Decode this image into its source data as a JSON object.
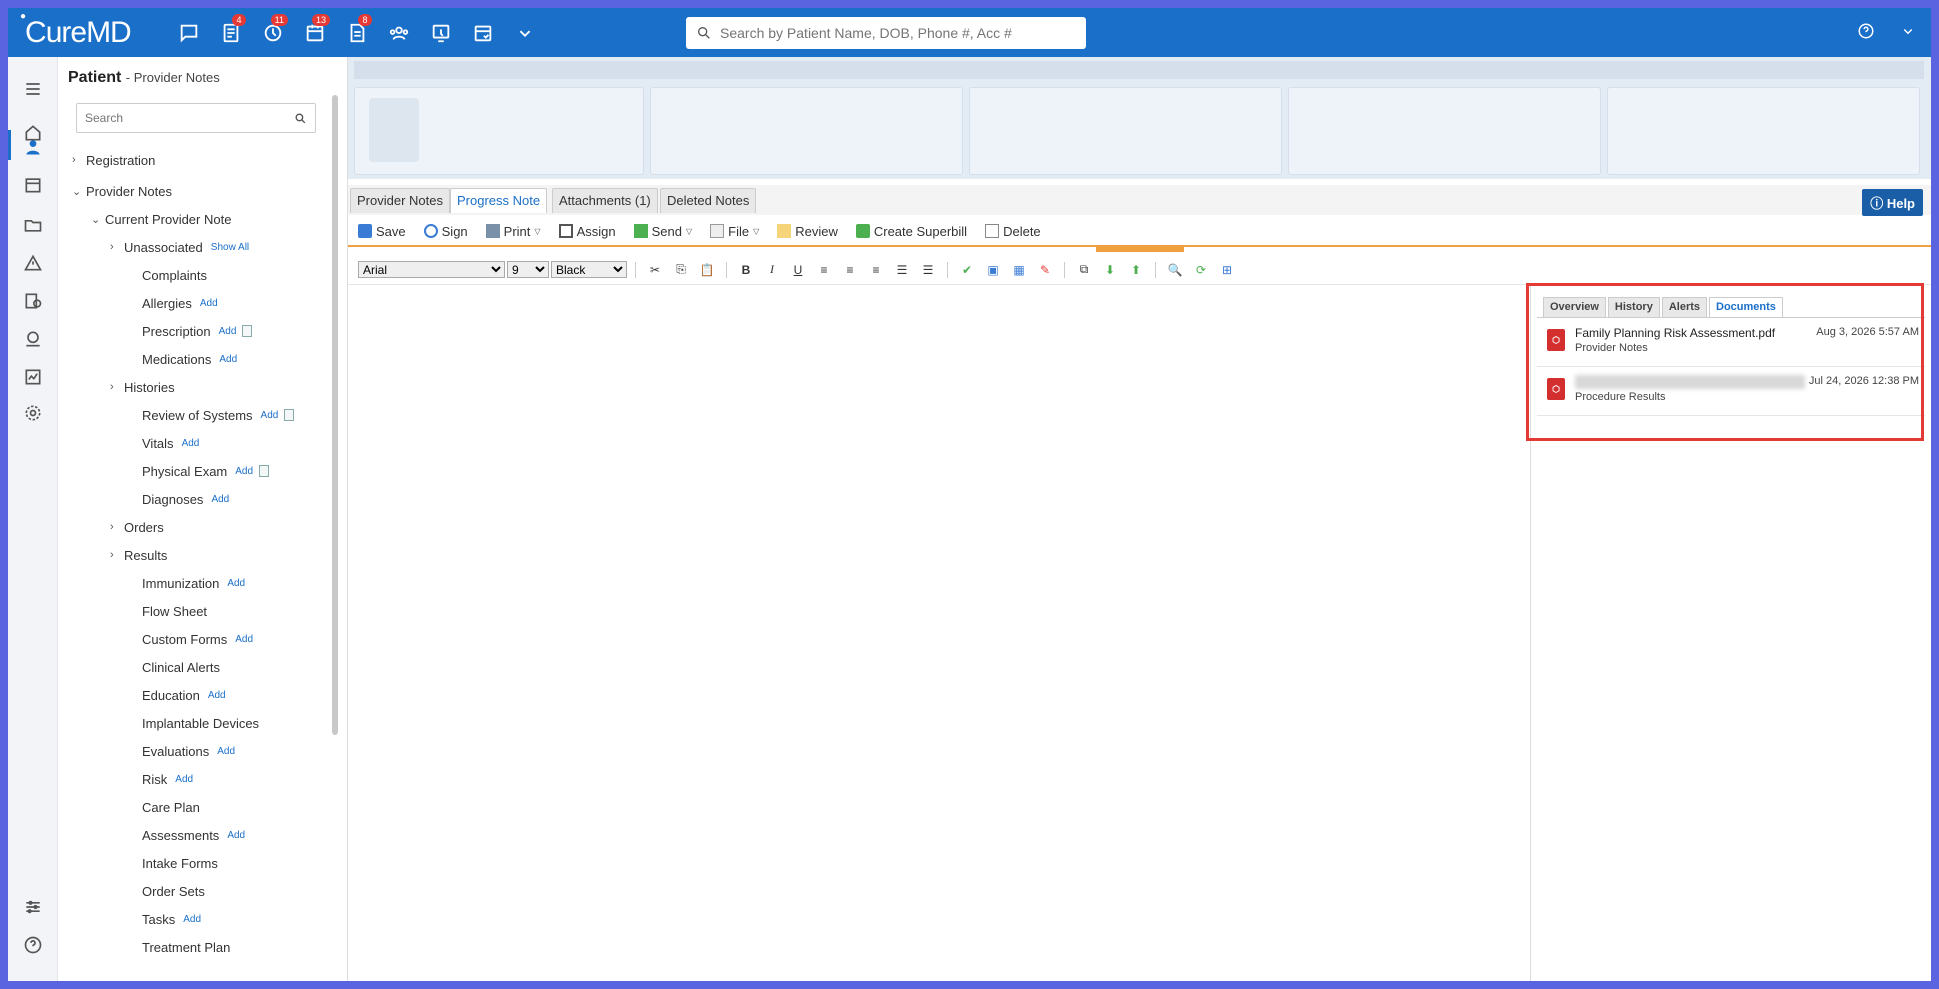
{
  "app": {
    "logo": "CureMD"
  },
  "topbar": {
    "badges": [
      "4",
      "11",
      "13",
      "8"
    ],
    "search_placeholder": "Search by Patient Name, DOB, Phone #, Acc #"
  },
  "nav": {
    "title": "Patient",
    "subtitle": "- Provider Notes",
    "search_placeholder": "Search",
    "items": [
      {
        "label": "Registration"
      },
      {
        "label": "Provider Notes"
      },
      {
        "label": "Current Provider Note"
      },
      {
        "label": "Unassociated",
        "extra": "Show All"
      },
      {
        "label": "Complaints"
      },
      {
        "label": "Allergies",
        "extra": "Add"
      },
      {
        "label": "Prescription",
        "extra": "Add"
      },
      {
        "label": "Medications",
        "extra": "Add"
      },
      {
        "label": "Histories"
      },
      {
        "label": "Review of Systems",
        "extra": "Add"
      },
      {
        "label": "Vitals",
        "extra": "Add"
      },
      {
        "label": "Physical Exam",
        "extra": "Add"
      },
      {
        "label": "Diagnoses",
        "extra": "Add"
      },
      {
        "label": "Orders"
      },
      {
        "label": "Results"
      },
      {
        "label": "Immunization",
        "extra": "Add"
      },
      {
        "label": "Flow Sheet"
      },
      {
        "label": "Custom Forms",
        "extra": "Add"
      },
      {
        "label": "Clinical Alerts"
      },
      {
        "label": "Education",
        "extra": "Add"
      },
      {
        "label": "Implantable Devices"
      },
      {
        "label": "Evaluations",
        "extra": "Add"
      },
      {
        "label": "Risk",
        "extra": "Add"
      },
      {
        "label": "Care Plan"
      },
      {
        "label": "Assessments",
        "extra": "Add"
      },
      {
        "label": "Intake Forms"
      },
      {
        "label": "Order Sets"
      },
      {
        "label": "Tasks",
        "extra": "Add"
      },
      {
        "label": "Treatment Plan"
      }
    ]
  },
  "tabs": [
    "Provider Notes",
    "Progress Note",
    "Attachments (1)",
    "Deleted Notes"
  ],
  "help_label": "Help",
  "toolbar": {
    "save": "Save",
    "sign": "Sign",
    "print": "Print",
    "assign": "Assign",
    "send": "Send",
    "file": "File",
    "review": "Review",
    "create_superbill": "Create Superbill",
    "delete": "Delete"
  },
  "format": {
    "font": "Arial",
    "size": "9",
    "color": "Black"
  },
  "right_panel": {
    "tabs": [
      "Overview",
      "History",
      "Alerts",
      "Documents"
    ],
    "documents": [
      {
        "name": "Family Planning Risk Assessment.pdf",
        "category": "Provider Notes",
        "date": "Aug 3, 2026 5:57 AM"
      },
      {
        "name": "",
        "category": "Procedure Results",
        "date": "Jul 24, 2026 12:38 PM"
      }
    ]
  },
  "colors": {
    "brand": "#1a6fc9",
    "highlight": "#e53935",
    "accent": "#f0a040"
  }
}
